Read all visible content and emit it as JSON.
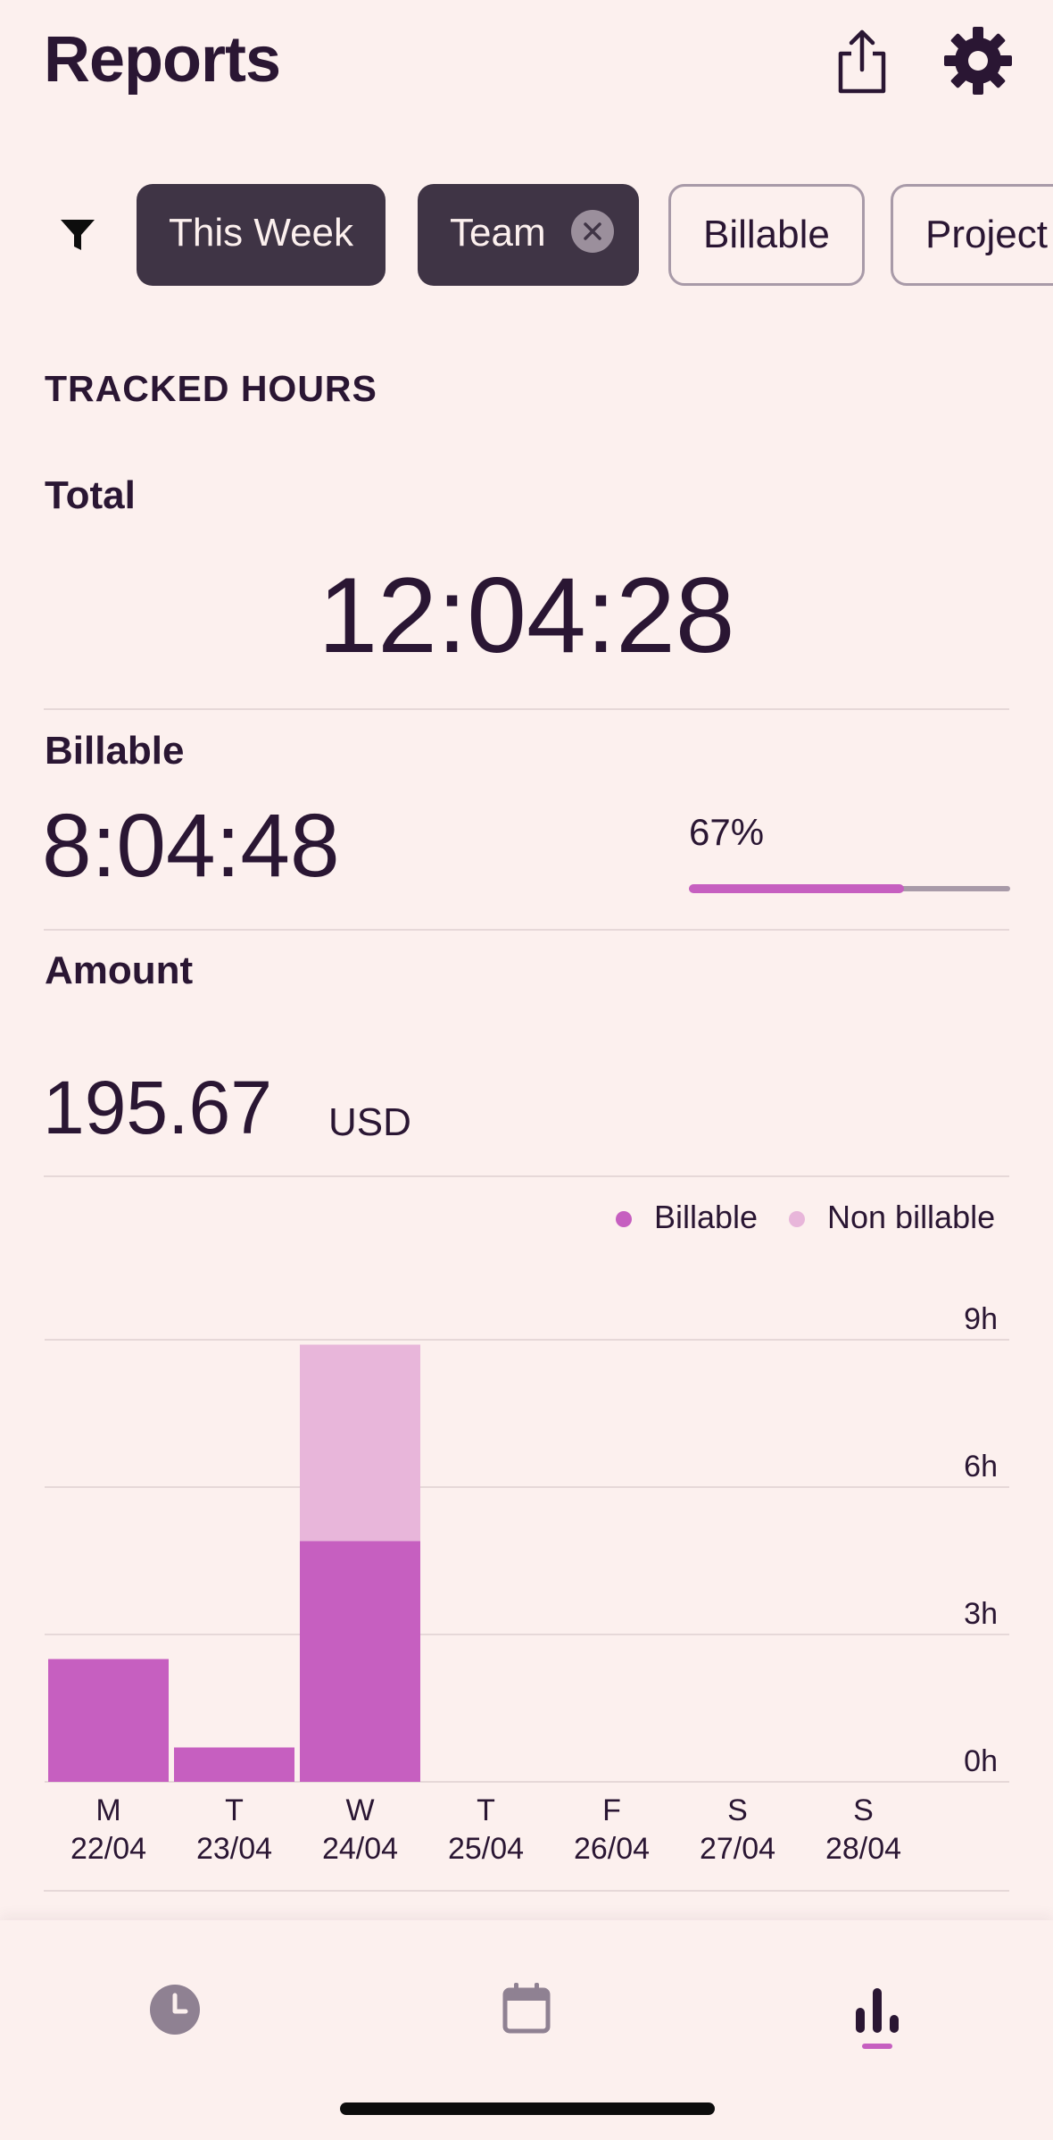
{
  "header": {
    "title": "Reports",
    "share_icon": "share-icon",
    "settings_icon": "gear-icon"
  },
  "filters": {
    "filter_icon": "filter-icon",
    "chips": [
      {
        "label": "This Week",
        "active": true
      },
      {
        "label": "Team",
        "active": true,
        "removable": true
      },
      {
        "label": "Billable",
        "active": false
      },
      {
        "label": "Project",
        "active": false
      }
    ]
  },
  "tracked": {
    "section_title": "TRACKED HOURS",
    "total_label": "Total",
    "total_value": "12:04:28",
    "billable_label": "Billable",
    "billable_value": "8:04:48",
    "billable_percent": "67%",
    "billable_fraction": 0.67,
    "amount_label": "Amount",
    "amount_value": "195.67",
    "amount_currency": "USD"
  },
  "colors": {
    "billable": "#c65fc0",
    "non_billable": "#e8b6da",
    "background": "#fcf0ee",
    "text": "#2a1633"
  },
  "chart_data": {
    "type": "bar",
    "stacked": true,
    "categories": [
      "M\n22/04",
      "T\n23/04",
      "W\n24/04",
      "T\n25/04",
      "F\n26/04",
      "S\n27/04",
      "S\n28/04"
    ],
    "day_letters": [
      "M",
      "T",
      "W",
      "T",
      "F",
      "S",
      "S"
    ],
    "dates": [
      "22/04",
      "23/04",
      "24/04",
      "25/04",
      "26/04",
      "27/04",
      "28/04"
    ],
    "series": [
      {
        "name": "Billable",
        "values": [
          2.5,
          0.7,
          4.9,
          0,
          0,
          0,
          0
        ]
      },
      {
        "name": "Non billable",
        "values": [
          0,
          0,
          4.0,
          0,
          0,
          0,
          0
        ]
      }
    ],
    "yticks": [
      "0h",
      "3h",
      "6h",
      "9h"
    ],
    "ylim": [
      0,
      9
    ],
    "legend": [
      "Billable",
      "Non billable"
    ],
    "legend_position": "top-right",
    "grid": true
  },
  "bottom_nav": {
    "items": [
      {
        "icon": "clock-icon",
        "active": false
      },
      {
        "icon": "calendar-icon",
        "active": false
      },
      {
        "icon": "bar-chart-icon",
        "active": true
      }
    ]
  }
}
